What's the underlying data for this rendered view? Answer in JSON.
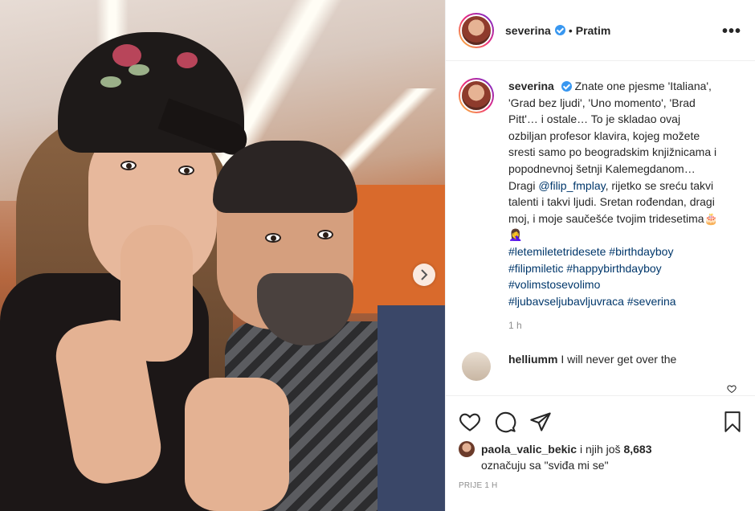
{
  "post": {
    "username": "severina",
    "follow_label": "Pratim",
    "dot": "•",
    "more_label": "•••"
  },
  "caption": {
    "username": "severina",
    "text_before_mention": "Znate one pjesme 'Italiana', 'Grad bez ljudi', 'Uno momento', 'Brad Pitt'… i ostale… To je skladao ovaj ozbiljan profesor klavira, kojeg možete sresti samo po beogradskim knjižnicama i popodnevnoj šetnji Kalemegdanom… Dragi ",
    "mention": "@filip_fmplay",
    "text_after_mention": ", rijetko se sreću takvi talenti i takvi ljudi. Sretan rođendan, dragi moj, i moje saučešće tvojim tridesetima🎂🤦‍♀️",
    "hashtags": [
      "#letemiletetridesete",
      "#birthdayboy",
      "#filipmiletic",
      "#happybirthdayboy",
      "#volimstosevolimo",
      "#ljubavseljubavljuvraca",
      "#severina"
    ],
    "time": "1 h"
  },
  "comment": {
    "username": "helliumm",
    "text": "I will never get over the"
  },
  "likes": {
    "liker": "paola_valic_bekic",
    "connector": "i njih još",
    "count": "8,683",
    "suffix": "označuju sa \"sviđa mi se\""
  },
  "post_time": "PRIJE 1 H",
  "colors": {
    "verified": "#3897f0",
    "link": "#00376b",
    "muted": "#8e8e8e"
  },
  "icons": [
    "heart-icon",
    "comment-icon",
    "share-icon",
    "bookmark-icon",
    "more-icon",
    "chevron-right-icon",
    "verified-icon"
  ]
}
